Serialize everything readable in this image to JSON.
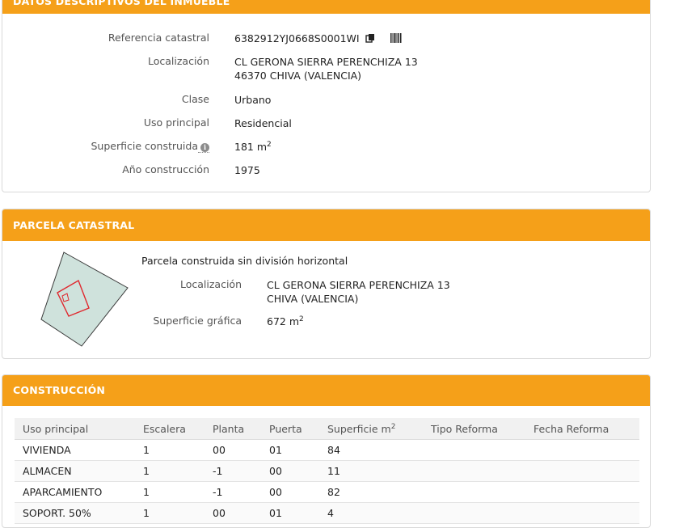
{
  "descriptivos": {
    "title": "DATOS DESCRIPTIVOS DEL INMUEBLE",
    "referencia_label": "Referencia catastral",
    "referencia_value": "6382912YJ0668S0001WI",
    "localizacion_label": "Localización",
    "localizacion_line1": "CL GERONA SIERRA PERENCHIZA 13",
    "localizacion_line2": "46370 CHIVA (VALENCIA)",
    "clase_label": "Clase",
    "clase_value": "Urbano",
    "uso_label": "Uso principal",
    "uso_value": "Residencial",
    "superficie_label": "Superficie construida",
    "superficie_value": "181 m",
    "superficie_exp": "2",
    "anio_label": "Año construcción",
    "anio_value": "1975",
    "icons": [
      "copy-icon",
      "barcode-icon",
      "info-icon"
    ]
  },
  "parcela": {
    "title": "PARCELA CATASTRAL",
    "subtitle": "Parcela construida sin división horizontal",
    "localizacion_label": "Localización",
    "localizacion_line1": "CL GERONA SIERRA PERENCHIZA 13",
    "localizacion_line2": "CHIVA (VALENCIA)",
    "superficie_label": "Superficie gráfica",
    "superficie_value": "672 m",
    "superficie_exp": "2",
    "colors": {
      "parcel_fill": "#cfe2dc",
      "building_outline": "#e0282e"
    }
  },
  "construccion": {
    "title": "CONSTRUCCIÓN",
    "headers": [
      "Uso principal",
      "Escalera",
      "Planta",
      "Puerta",
      "Superficie m",
      "Tipo Reforma",
      "Fecha Reforma"
    ],
    "superficie_header_exp": "2",
    "rows": [
      [
        "VIVIENDA",
        "1",
        "00",
        "01",
        "84",
        "",
        ""
      ],
      [
        "ALMACEN",
        "1",
        "-1",
        "00",
        "11",
        "",
        ""
      ],
      [
        "APARCAMIENTO",
        "1",
        "-1",
        "00",
        "82",
        "",
        ""
      ],
      [
        "SOPORT. 50%",
        "1",
        "00",
        "01",
        "4",
        "",
        ""
      ]
    ]
  },
  "colors": {
    "accent": "#f5a019",
    "border": "#d9d9d9"
  }
}
